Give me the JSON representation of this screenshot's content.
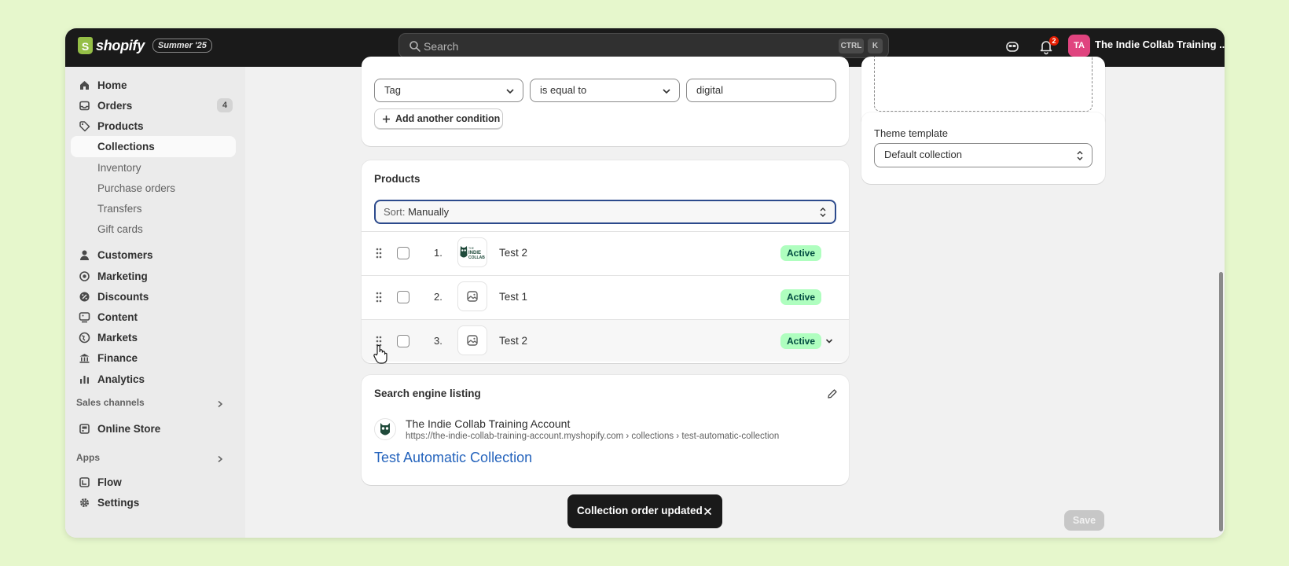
{
  "topbar": {
    "logo_text": "shopify",
    "logo_glyph": "S",
    "edition_badge": "Summer '25",
    "search_placeholder": "Search",
    "shortcut_keys": [
      "CTRL",
      "K"
    ],
    "notification_count": "2",
    "avatar_initials": "TA",
    "store_name": "The Indie Collab Training ...",
    "colors": {
      "bar": "#1a1a1a",
      "avatar": "#e0447f",
      "logo": "#95bf47"
    }
  },
  "sidebar": {
    "items": [
      {
        "label": "Home",
        "icon": "home-icon"
      },
      {
        "label": "Orders",
        "icon": "inbox-icon",
        "badge": "4"
      },
      {
        "label": "Products",
        "icon": "tag-icon"
      },
      {
        "label": "Collections",
        "selected": true
      },
      {
        "label": "Inventory"
      },
      {
        "label": "Purchase orders"
      },
      {
        "label": "Transfers"
      },
      {
        "label": "Gift cards"
      },
      {
        "label": "Customers",
        "icon": "person-icon"
      },
      {
        "label": "Marketing",
        "icon": "target-icon"
      },
      {
        "label": "Discounts",
        "icon": "discount-icon"
      },
      {
        "label": "Content",
        "icon": "content-icon"
      },
      {
        "label": "Markets",
        "icon": "globe-icon"
      },
      {
        "label": "Finance",
        "icon": "bank-icon"
      },
      {
        "label": "Analytics",
        "icon": "bar-chart-icon"
      }
    ],
    "sales_channels": {
      "title": "Sales channels",
      "items": [
        {
          "label": "Online Store",
          "icon": "store-icon"
        }
      ]
    },
    "apps": {
      "title": "Apps",
      "items": [
        {
          "label": "Flow",
          "icon": "flow-icon"
        }
      ]
    },
    "settings_label": "Settings"
  },
  "conditions": {
    "field": "Tag",
    "operator": "is equal to",
    "value": "digital",
    "add_condition_label": "Add another condition"
  },
  "products": {
    "title": "Products",
    "sort_prefix": "Sort:",
    "sort_value": "Manually",
    "rows": [
      {
        "num": "1.",
        "name": "Test 2",
        "status": "Active",
        "thumb": "indie-collab-logo"
      },
      {
        "num": "2.",
        "name": "Test 1",
        "status": "Active",
        "thumb": "image-placeholder-icon"
      },
      {
        "num": "3.",
        "name": "Test 2",
        "status": "Active",
        "thumb": "image-placeholder-icon"
      }
    ],
    "logo_text": [
      "THE",
      "INDIE",
      "COLLAB"
    ]
  },
  "seo": {
    "title": "Search engine listing",
    "site_name": "The Indie Collab Training Account",
    "url": "https://the-indie-collab-training-account.myshopify.com › collections › test-automatic-collection",
    "page_title": "Test Automatic Collection"
  },
  "theme_template": {
    "label": "Theme template",
    "value": "Default collection"
  },
  "toast": {
    "message": "Collection order updated"
  },
  "save_label": "Save"
}
